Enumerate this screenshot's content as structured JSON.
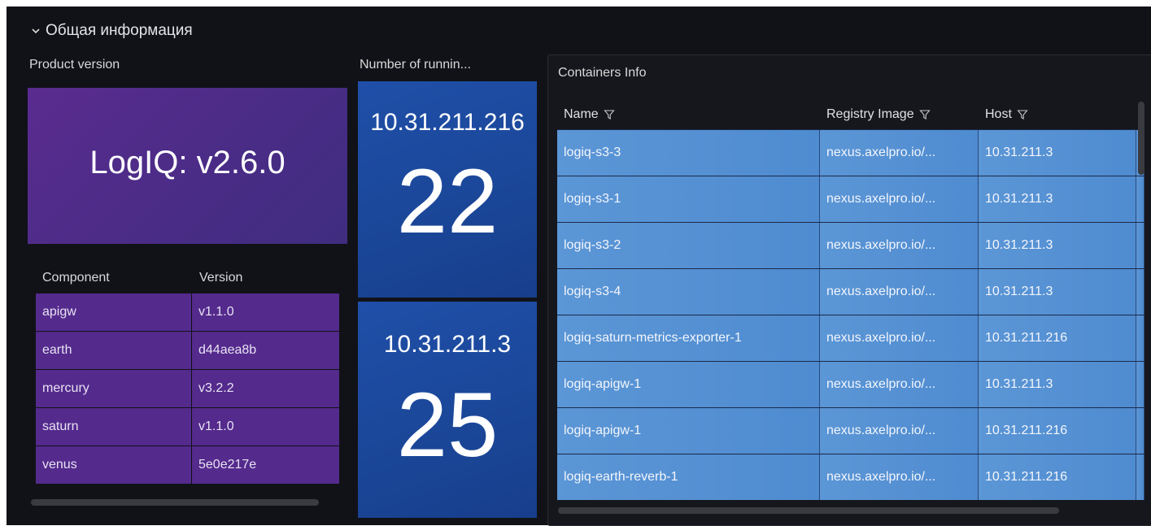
{
  "row": {
    "title": "Общая информация",
    "chevron_icon": "chevron-down-icon"
  },
  "product_version": {
    "title": "Product version",
    "value": "LogIQ: v2.6.0",
    "color": "#5a2b8f"
  },
  "components": {
    "headers": [
      "Component",
      "Version"
    ],
    "rows": [
      {
        "component": "apigw",
        "version": "v1.1.0"
      },
      {
        "component": "earth",
        "version": "d44aea8b"
      },
      {
        "component": "mercury",
        "version": "v3.2.2"
      },
      {
        "component": "saturn",
        "version": "v1.1.0"
      },
      {
        "component": "venus",
        "version": "5e0e217e"
      }
    ],
    "color": "#542a8d"
  },
  "running": {
    "title": "Number of runnin...",
    "items": [
      {
        "host": "10.31.211.216",
        "count": "22"
      },
      {
        "host": "10.31.211.3",
        "count": "25"
      }
    ],
    "color": "#1f4fa8"
  },
  "containers": {
    "title": "Containers Info",
    "headers": [
      "Name",
      "Registry Image",
      "Host"
    ],
    "filter_icon": "filter-icon",
    "rows": [
      {
        "name": "logiq-s3-3",
        "image": "nexus.axelpro.io/...",
        "host": "10.31.211.3"
      },
      {
        "name": "logiq-s3-1",
        "image": "nexus.axelpro.io/...",
        "host": "10.31.211.3"
      },
      {
        "name": "logiq-s3-2",
        "image": "nexus.axelpro.io/...",
        "host": "10.31.211.3"
      },
      {
        "name": "logiq-s3-4",
        "image": "nexus.axelpro.io/...",
        "host": "10.31.211.3"
      },
      {
        "name": "logiq-saturn-metrics-exporter-1",
        "image": "nexus.axelpro.io/...",
        "host": "10.31.211.216"
      },
      {
        "name": "logiq-apigw-1",
        "image": "nexus.axelpro.io/...",
        "host": "10.31.211.3"
      },
      {
        "name": "logiq-apigw-1",
        "image": "nexus.axelpro.io/...",
        "host": "10.31.211.216"
      },
      {
        "name": "logiq-earth-reverb-1",
        "image": "nexus.axelpro.io/...",
        "host": "10.31.211.216"
      }
    ],
    "color": "#5b96d6"
  }
}
